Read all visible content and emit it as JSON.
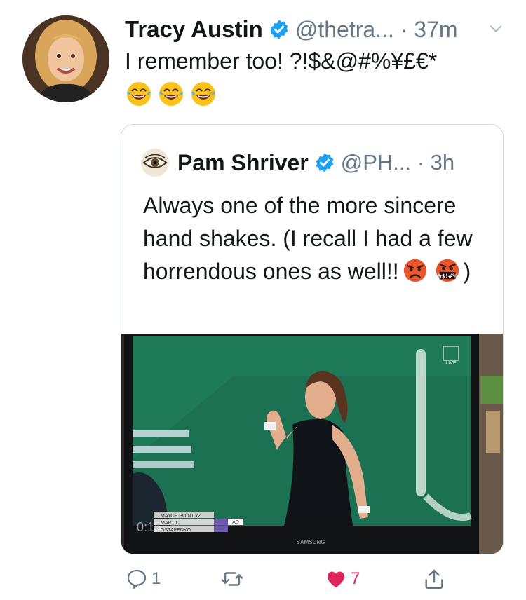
{
  "tweet": {
    "author_name": "Tracy Austin",
    "author_handle": "@thetra... · 37m",
    "text": "I remember too!    ?!$&@#%¥£€*",
    "emojis": [
      "tears-of-joy",
      "tears-of-joy",
      "tears-of-joy"
    ]
  },
  "quoted": {
    "author_name": "Pam Shriver",
    "author_handle": "@PH... · 3h",
    "text_part1": "Always one of the more sincere hand shakes. (I recall I had a few horrendous ones as well!!",
    "text_part2": ")",
    "emojis": [
      "pouting-face",
      "face-with-symbols-on-mouth"
    ],
    "media": {
      "scoreboard_label": "MATCH POINT x2",
      "player1": "MARTIC",
      "player2": "OSTAPENKO",
      "score_tag": "AD",
      "timer": "0:15",
      "tv_brand": "SAMSUNG",
      "channel_logo": "LIVE"
    }
  },
  "actions": {
    "reply_count": "1",
    "retweet_count": "",
    "like_count": "7",
    "share_label": ""
  },
  "colors": {
    "verified": "#1da1f2",
    "like": "#e0245e",
    "secondary_text": "#657786",
    "court_green": "#1f7a58"
  }
}
